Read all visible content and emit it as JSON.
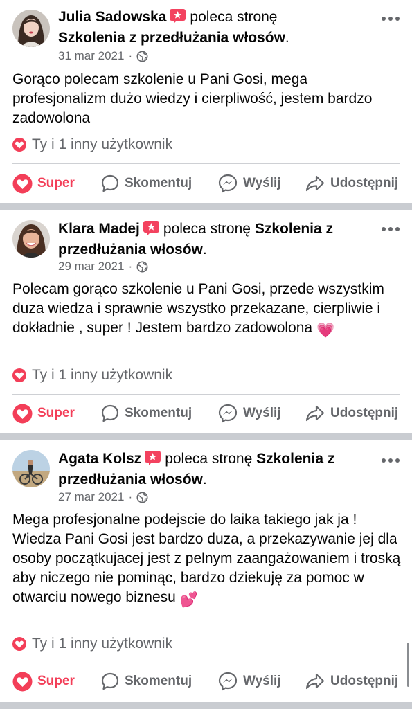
{
  "posts": [
    {
      "author": "Julia Sadowska",
      "recommends_text": "poleca stronę",
      "page_name": "Szkolenia z przedłużania włosów",
      "date": "31 mar 2021",
      "text": "Gorąco polecam szkolenie u Pani Gosi, mega profesjonalizm dużo wiedzy i cierpliwość, jestem bardzo zadowolona",
      "emoji": "",
      "reactions": "Ty i 1 inny użytkownik"
    },
    {
      "author": "Klara Madej",
      "recommends_text": "poleca stronę",
      "page_name": "Szkolenia z przedłużania włosów",
      "date": "29 mar 2021",
      "text": "Polecam gorąco szkolenie u Pani Gosi, przede wszystkim duza wiedza i sprawnie wszystko przekazane, cierpliwie i dokładnie , super ! Jestem bardzo zadowolona",
      "emoji": "💗",
      "reactions": "Ty i 1 inny użytkownik"
    },
    {
      "author": "Agata Kolsz",
      "recommends_text": "poleca stronę",
      "page_name": "Szkolenia z przedłużania włosów",
      "date": "27 mar 2021",
      "text": "Mega profesjonalne podejscie do laika takiego jak ja ! Wiedza Pani Gosi jest bardzo duza, a przekazywanie jej dla osoby początkujacej jest z pelnym zaangażowaniem i troską aby niczego nie pominąc, bardzo dziekuję za pomoc w otwarciu nowego biznesu",
      "emoji": "💕",
      "reactions": "Ty i 1 inny użytkownik"
    }
  ],
  "actions": {
    "super": "Super",
    "comment": "Skomentuj",
    "send": "Wyślij",
    "share": "Udostępnij"
  },
  "icons": {
    "recommend": "recommend-badge-icon",
    "privacy": "globe-icon",
    "more": "more-options-icon",
    "reaction": "heart-reaction-icon",
    "super": "heart-icon",
    "comment": "comment-bubble-icon",
    "send": "messenger-icon",
    "share": "share-arrow-icon"
  },
  "colors": {
    "super_red": "#f33e58",
    "secondary_text": "#65676b",
    "separator": "#c9ccd1"
  }
}
